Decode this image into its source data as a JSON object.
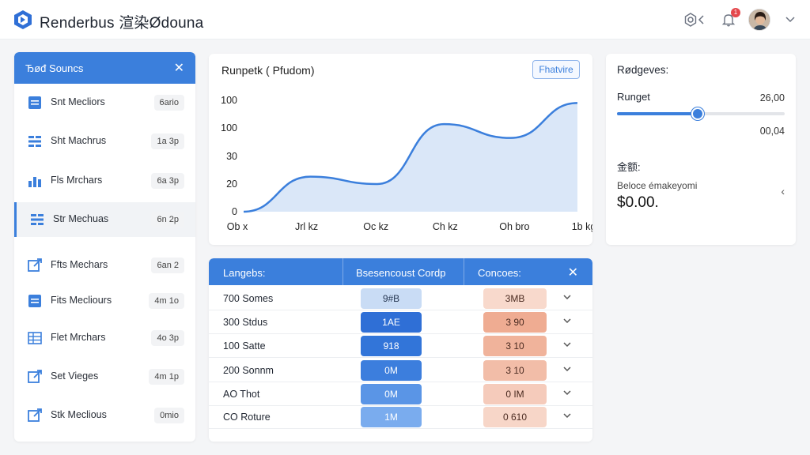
{
  "header": {
    "app_title": "Renderbus 渲染Ødouna",
    "notification_count": "1",
    "icons": [
      "logo-icon",
      "settings-icon",
      "chevron-left-icon",
      "bell-icon",
      "avatar",
      "chevron-down-icon"
    ]
  },
  "sidebar": {
    "title": "Ђøđ Souncs",
    "items": [
      {
        "label": "Snt Mecliors",
        "tag": "6ario",
        "icon": "list-icon",
        "active": false
      },
      {
        "label": "Sht Machrus",
        "tag": "1a 3p",
        "icon": "bars-icon",
        "active": false
      },
      {
        "label": "Fls Mrchars",
        "tag": "6a 3p",
        "icon": "chart-icon",
        "active": false
      },
      {
        "label": "Str Mechuas",
        "tag": "6n 2p",
        "icon": "bars-icon",
        "active": true
      },
      {
        "label": "Ffts Mechars",
        "tag": "6an 2",
        "icon": "external-icon",
        "active": false
      },
      {
        "label": "Fits Mecliours",
        "tag": "4m 1o",
        "icon": "list-icon",
        "active": false
      },
      {
        "label": "Flet Mrchars",
        "tag": "4o 3p",
        "icon": "grid-icon",
        "active": false
      },
      {
        "label": "Set Vieges",
        "tag": "4m 1p",
        "icon": "external-icon",
        "active": false
      },
      {
        "label": "Stk Meclious",
        "tag": "0mio",
        "icon": "external-icon",
        "active": false
      }
    ]
  },
  "chart": {
    "title": "Runpetk ( Pfudom)",
    "button_label": "Fhatvire",
    "accent": "#3b7fdc",
    "fill": "#d6e4f7"
  },
  "chart_data": {
    "type": "area",
    "title": "Runpetk ( Pfudom)",
    "y_tick_labels": [
      "100",
      "100",
      "30",
      "20",
      "0"
    ],
    "x_tick_labels": [
      "Ob x",
      "Jrl kz",
      "Oc kz",
      "Ch kz",
      "Oh bro",
      "1b kg"
    ],
    "series": [
      {
        "values": [
          0,
          38,
          30,
          95,
          80,
          118
        ]
      }
    ],
    "grid": false,
    "legend": "none"
  },
  "right_panel": {
    "title": "Rødgeves:",
    "range_label": "Runget",
    "range_value": "26,00",
    "slider_fraction": 0.48,
    "sub_value": "00,04",
    "cost_label": "金额:",
    "balance_label": "Beloce émakeyomi",
    "balance_value": "$0.00."
  },
  "table": {
    "headers": [
      "Langebs:",
      "Bsesencoust Cordp",
      "Concoes:"
    ],
    "rows": [
      {
        "name": "700 Somes",
        "blue": "9#B",
        "red": "3MB",
        "blue_color": "#c9dcf5",
        "red_color": "#f8d9cc",
        "blue_text": "#2a3a55"
      },
      {
        "name": "300 Stdus",
        "blue": "1AE",
        "red": "3 90",
        "blue_color": "#2f6fd6",
        "red_color": "#efac92",
        "blue_text": "#ffffff"
      },
      {
        "name": "100 Satte",
        "blue": "918",
        "red": "3 10",
        "blue_color": "#3275d9",
        "red_color": "#f0b39b",
        "blue_text": "#ffffff"
      },
      {
        "name": "200 Sonnm",
        "blue": "0M",
        "red": "3 10",
        "blue_color": "#3c7edd",
        "red_color": "#f2bda8",
        "blue_text": "#ffffff"
      },
      {
        "name": "AO Thot",
        "blue": "0M",
        "red": "0 IM",
        "blue_color": "#5a95e6",
        "red_color": "#f5cbbb",
        "blue_text": "#ffffff"
      },
      {
        "name": "CO Roture",
        "blue": "1M",
        "red": "0 610",
        "blue_color": "#7aacee",
        "red_color": "#f7d6c8",
        "blue_text": "#ffffff"
      }
    ]
  }
}
